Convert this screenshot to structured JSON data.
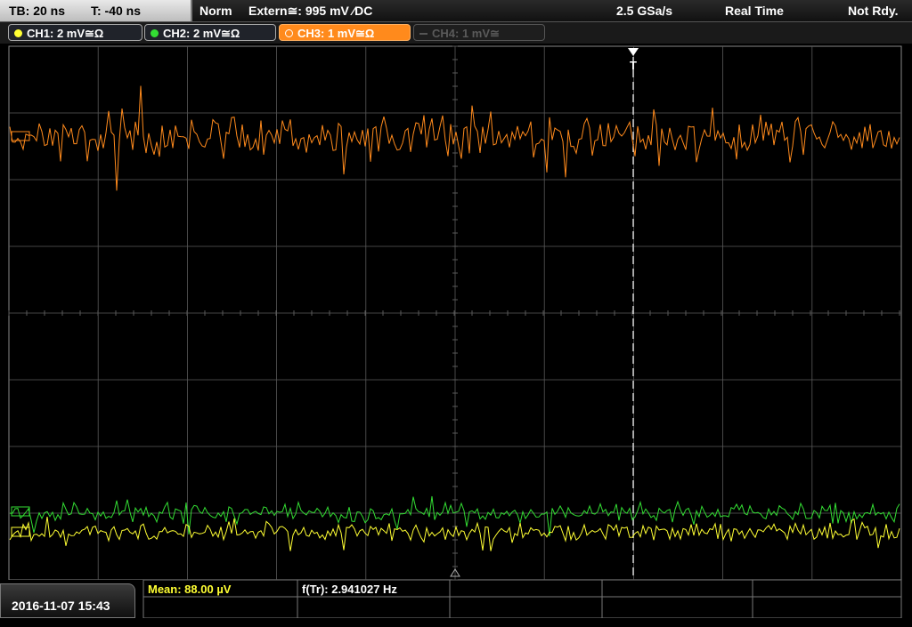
{
  "timebase": {
    "tb": "TB: 20 ns",
    "t": "T: -40 ns"
  },
  "trigger": {
    "mode": "Norm",
    "source": "Extern≅: 995 mV ⁄DC"
  },
  "acquisition": {
    "sample_rate": "2.5 GSa/s",
    "mode": "Real Time",
    "status": "Not Rdy."
  },
  "channels": [
    {
      "label": "CH1: 2 mV≅Ω",
      "color": "#ffff33",
      "active": true
    },
    {
      "label": "CH2: 2 mV≅Ω",
      "color": "#33dd33",
      "active": true
    },
    {
      "label": "CH3: 1 mV≅Ω",
      "color": "#ff8a1c",
      "active": true,
      "selected": true
    },
    {
      "label": "CH4: 1 mV≅",
      "color": "#555555",
      "active": false
    }
  ],
  "trigger_marker": "T",
  "measurements": {
    "mean": "Mean: 88.00 µV",
    "frequency": "f(Tr): 2.941027 Hz"
  },
  "datetime": "2016-11-07 15:43",
  "colors": {
    "ch1": "#ffff33",
    "ch2": "#33dd33",
    "ch3": "#ff8a1c",
    "grid": "#5a5a5a"
  }
}
